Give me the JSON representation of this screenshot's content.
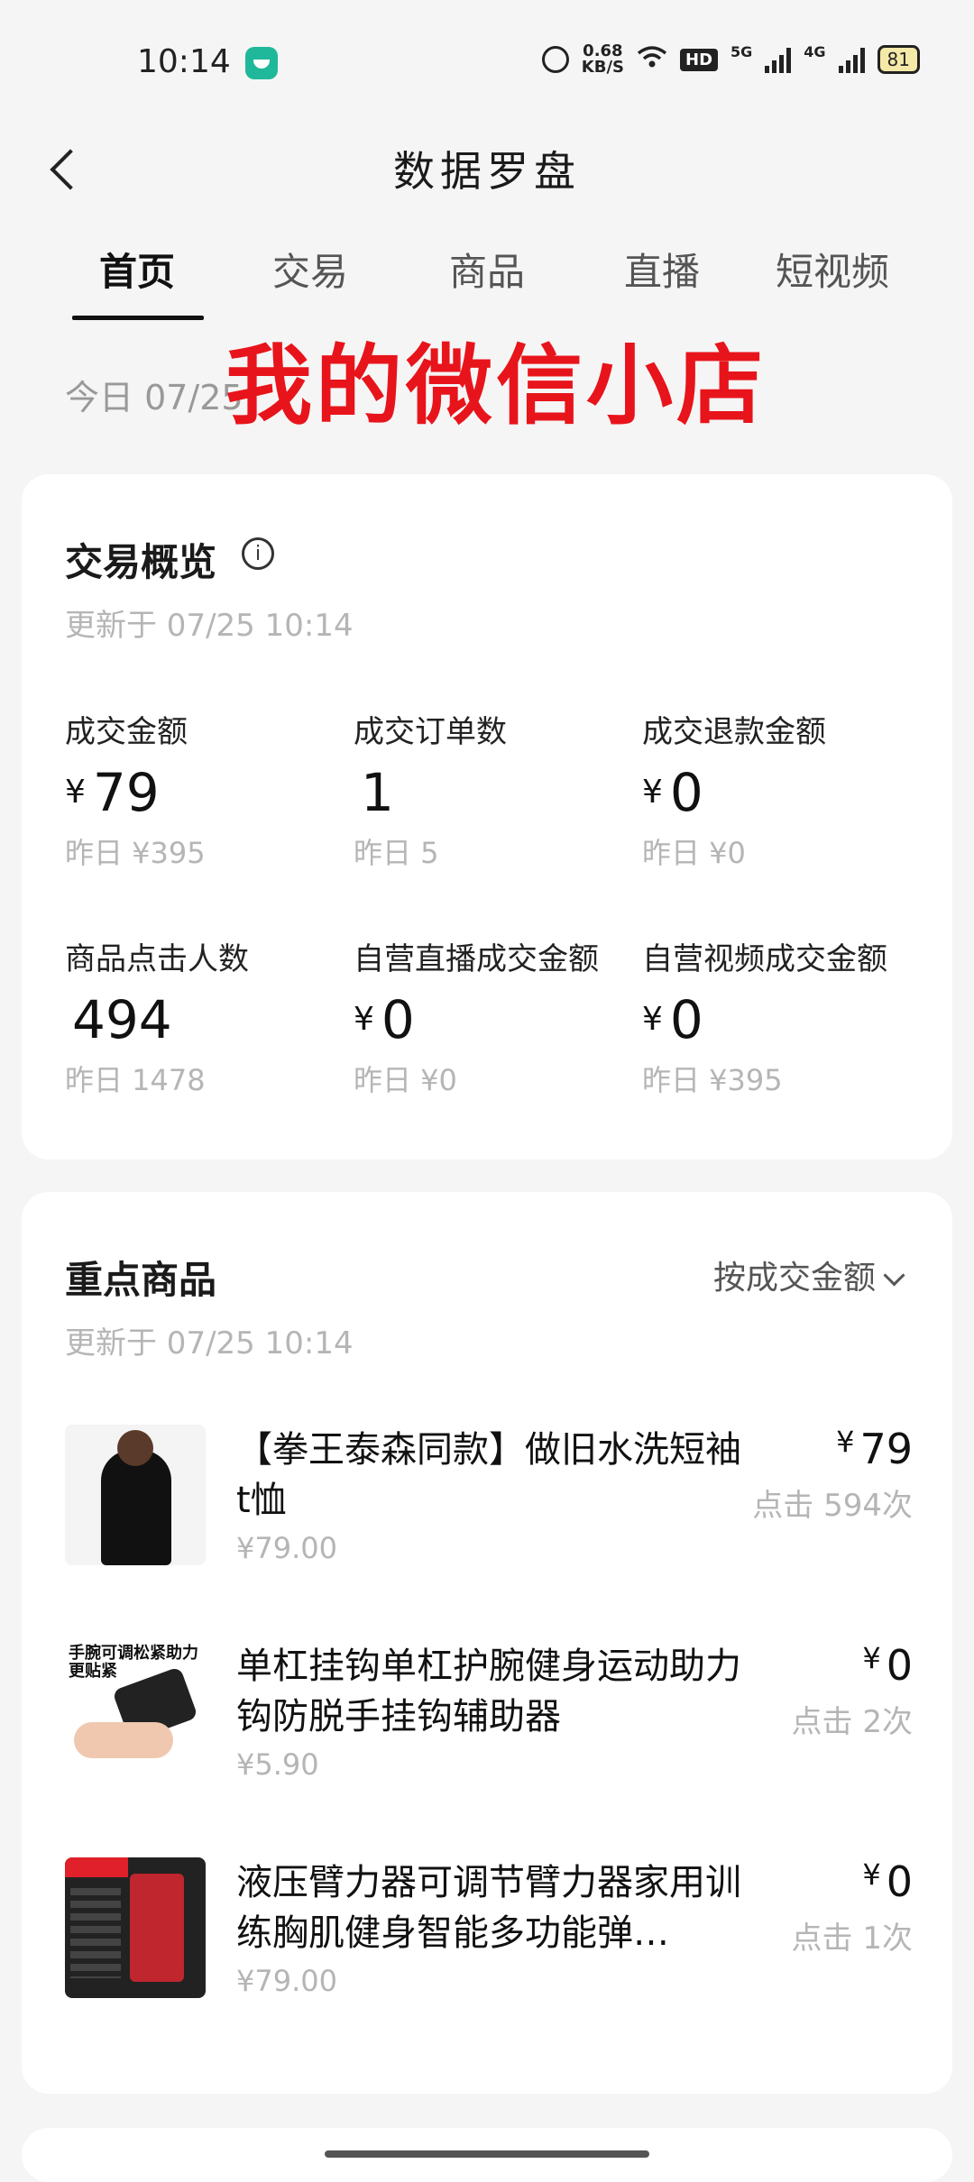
{
  "status": {
    "time": "10:14",
    "speed_value": "0.68",
    "speed_unit": "KB/S",
    "hd": "HD",
    "net1": "5G",
    "net2": "4G",
    "battery": "81"
  },
  "nav": {
    "title": "数据罗盘"
  },
  "tabs": [
    {
      "label": "首页",
      "active": true
    },
    {
      "label": "交易"
    },
    {
      "label": "商品"
    },
    {
      "label": "直播"
    },
    {
      "label": "短视频"
    }
  ],
  "date_label": "今日 07/25",
  "overlay_text": "我的微信小店",
  "overview": {
    "title": "交易概览",
    "info_icon": "i",
    "updated": "更新于 07/25 10:14",
    "metrics": [
      {
        "label": "成交金额",
        "currency": "¥",
        "value": "79",
        "prev": "昨日 ¥395"
      },
      {
        "label": "成交订单数",
        "currency": "",
        "value": "1",
        "prev": "昨日 5"
      },
      {
        "label": "成交退款金额",
        "currency": "¥",
        "value": "0",
        "prev": "昨日 ¥0"
      },
      {
        "label": "商品点击人数",
        "currency": "",
        "value": "494",
        "prev": "昨日 1478"
      },
      {
        "label": "自营直播成交金额",
        "currency": "¥",
        "value": "0",
        "prev": "昨日 ¥0"
      },
      {
        "label": "自营视频成交金额",
        "currency": "¥",
        "value": "0",
        "prev": "昨日 ¥395"
      }
    ]
  },
  "products_section": {
    "title": "重点商品",
    "updated": "更新于 07/25 10:14",
    "sort_label": "按成交金额",
    "items": [
      {
        "title": "【拳王泰森同款】做旧水洗短袖t恤",
        "price": "¥79.00",
        "currency": "¥",
        "amount": "79",
        "clicks": "点击 594次"
      },
      {
        "title": "单杠挂钩单杠护腕健身运动助力钩防脱手挂钩辅助器",
        "price": "¥5.90",
        "currency": "¥",
        "amount": "0",
        "clicks": "点击 2次",
        "thumb_text": "手腕可调松紧助力更贴紧"
      },
      {
        "title": "液压臂力器可调节臂力器家用训练胸肌健身智能多功能弹…",
        "price": "¥79.00",
        "currency": "¥",
        "amount": "0",
        "clicks": "点击 1次"
      }
    ]
  }
}
